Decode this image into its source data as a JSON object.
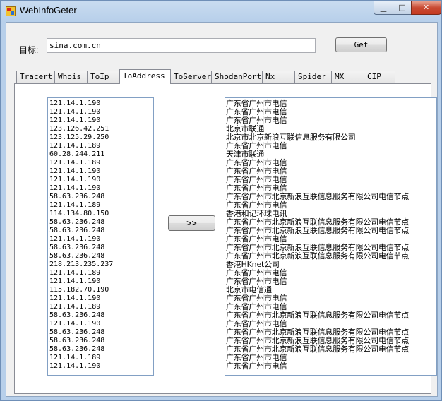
{
  "window": {
    "title": "WebInfoGeter",
    "minimize_glyph": "▁",
    "maximize_glyph": "□",
    "close_glyph": "✕"
  },
  "form": {
    "target_label": "目标:",
    "target_value": "sina.com.cn",
    "get_label": "Get"
  },
  "tabs": [
    {
      "label": "Tracert",
      "active": false
    },
    {
      "label": "Whois",
      "active": false
    },
    {
      "label": "ToIp",
      "active": false
    },
    {
      "label": "ToAddress",
      "active": true
    },
    {
      "label": "ToServer",
      "active": false
    },
    {
      "label": "ShodanPort",
      "active": false
    },
    {
      "label": "Nx",
      "active": false
    },
    {
      "label": "Spider",
      "active": false
    },
    {
      "label": "MX",
      "active": false
    },
    {
      "label": "CIP",
      "active": false
    }
  ],
  "convert_label": ">>",
  "ips": [
    "121.14.1.190",
    "121.14.1.190",
    "121.14.1.190",
    "123.126.42.251",
    "123.125.29.250",
    "121.14.1.189",
    "60.28.244.211",
    "121.14.1.189",
    "121.14.1.190",
    "121.14.1.190",
    "121.14.1.190",
    "58.63.236.248",
    "121.14.1.189",
    "114.134.80.150",
    "58.63.236.248",
    "58.63.236.248",
    "121.14.1.190",
    "58.63.236.248",
    "58.63.236.248",
    "218.213.235.237",
    "121.14.1.189",
    "121.14.1.190",
    "115.182.70.190",
    "121.14.1.190",
    "121.14.1.189",
    "58.63.236.248",
    "121.14.1.190",
    "58.63.236.248",
    "58.63.236.248",
    "58.63.236.248",
    "121.14.1.189",
    "121.14.1.190"
  ],
  "addresses": [
    "广东省广州市电信",
    "广东省广州市电信",
    "广东省广州市电信",
    "北京市联通",
    "北京市北京新浪互联信息服务有限公司",
    "广东省广州市电信",
    "天津市联通",
    "广东省广州市电信",
    "广东省广州市电信",
    "广东省广州市电信",
    "广东省广州市电信",
    "广东省广州市北京新浪互联信息服务有限公司电信节点",
    "广东省广州市电信",
    "香港和记环球电讯",
    "广东省广州市北京新浪互联信息服务有限公司电信节点",
    "广东省广州市北京新浪互联信息服务有限公司电信节点",
    "广东省广州市电信",
    "广东省广州市北京新浪互联信息服务有限公司电信节点",
    "广东省广州市北京新浪互联信息服务有限公司电信节点",
    "香港HKnet公司",
    "广东省广州市电信",
    "广东省广州市电信",
    "北京市电信通",
    "广东省广州市电信",
    "广东省广州市电信",
    "广东省广州市北京新浪互联信息服务有限公司电信节点",
    "广东省广州市电信",
    "广东省广州市北京新浪互联信息服务有限公司电信节点",
    "广东省广州市北京新浪互联信息服务有限公司电信节点",
    "广东省广州市北京新浪互联信息服务有限公司电信节点",
    "广东省广州市电信",
    "广东省广州市电信"
  ]
}
